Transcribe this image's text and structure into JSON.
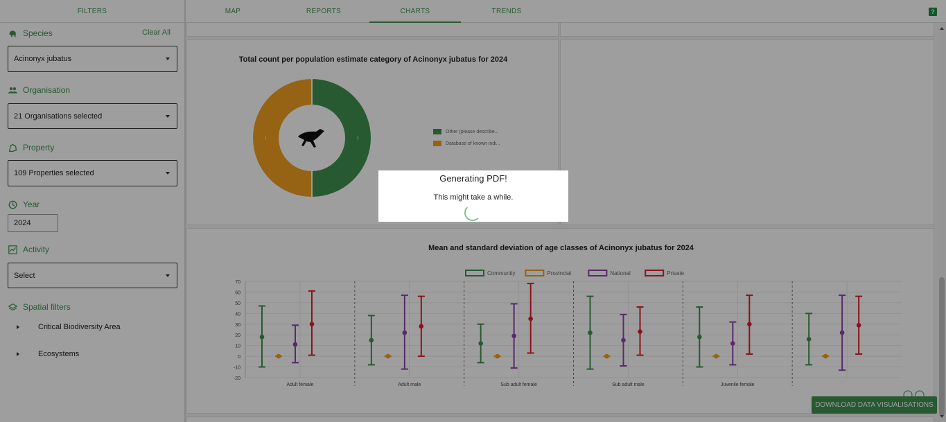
{
  "nav": {
    "filters": "FILTERS",
    "tabs": [
      "MAP",
      "REPORTS",
      "CHARTS",
      "TRENDS"
    ],
    "active_tab": "CHARTS",
    "help": "?"
  },
  "sidebar": {
    "species_label": "Species",
    "clear_all": "Clear All",
    "species_value": "Acinonyx jubatus",
    "organisation_label": "Organisation",
    "organisation_value": "21 Organisations selected",
    "property_label": "Property",
    "property_value": "109 Properties selected",
    "year_label": "Year",
    "year_value": "2024",
    "activity_label": "Activity",
    "activity_value": "Select",
    "spatial_label": "Spatial filters",
    "spatial_items": [
      "Critical Biodiversity Area",
      "Ecosystems"
    ]
  },
  "donut_card": {
    "title": "Total count per population estimate category of Acinonyx jubatus for 2024",
    "legend": [
      {
        "label": "Other (please describe...",
        "color": "#3f9250"
      },
      {
        "label": "Database of known indi...",
        "color": "#f0a020"
      }
    ]
  },
  "chart_data": [
    {
      "type": "pie",
      "title": "Total count per population estimate category of Acinonyx jubatus for 2024",
      "categories": [
        "Other (please describe...",
        "Database of known indi..."
      ],
      "values": [
        1,
        1
      ],
      "colors": [
        "#3f9250",
        "#f0a020"
      ]
    },
    {
      "type": "scatter",
      "title": "Mean and standard deviation of age classes of Acinonyx jubatus for 2024",
      "categories": [
        "Adult female",
        "Adult male",
        "Sub adult female",
        "Sub adult male",
        "Juvenile female",
        ""
      ],
      "ylim": [
        -20,
        70
      ],
      "yticks": [
        -20,
        -10,
        0,
        10,
        20,
        30,
        40,
        50,
        60,
        70
      ],
      "series": [
        {
          "name": "Community",
          "color": "#3f9250",
          "mean": [
            18,
            15,
            12,
            22,
            18,
            16
          ],
          "low": [
            -10,
            -8,
            -6,
            -12,
            -10,
            -8
          ],
          "high": [
            47,
            38,
            30,
            56,
            46,
            40
          ]
        },
        {
          "name": "Provincial",
          "color": "#f0a020",
          "mean": [
            0,
            0,
            0,
            0,
            0,
            0
          ],
          "low": [
            0,
            0,
            0,
            0,
            0,
            0
          ],
          "high": [
            0,
            0,
            0,
            0,
            0,
            0
          ]
        },
        {
          "name": "National",
          "color": "#8e44ad",
          "mean": [
            11,
            22,
            19,
            15,
            12,
            22
          ],
          "low": [
            -6,
            -12,
            -11,
            -9,
            -8,
            -13
          ],
          "high": [
            29,
            57,
            49,
            39,
            32,
            57
          ]
        },
        {
          "name": "Private",
          "color": "#e0202a",
          "mean": [
            30,
            28,
            35,
            23,
            30,
            29
          ],
          "low": [
            1,
            0,
            3,
            1,
            2,
            2
          ],
          "high": [
            61,
            56,
            68,
            46,
            57,
            56
          ]
        }
      ]
    }
  ],
  "bar_card": {
    "title": "Mean and standard deviation of age classes of Acinonyx jubatus for 2024"
  },
  "download_button": "DOWNLOAD DATA VISUALISATIONS",
  "modal": {
    "title": "Generating PDF!",
    "message": "This might take a while."
  }
}
